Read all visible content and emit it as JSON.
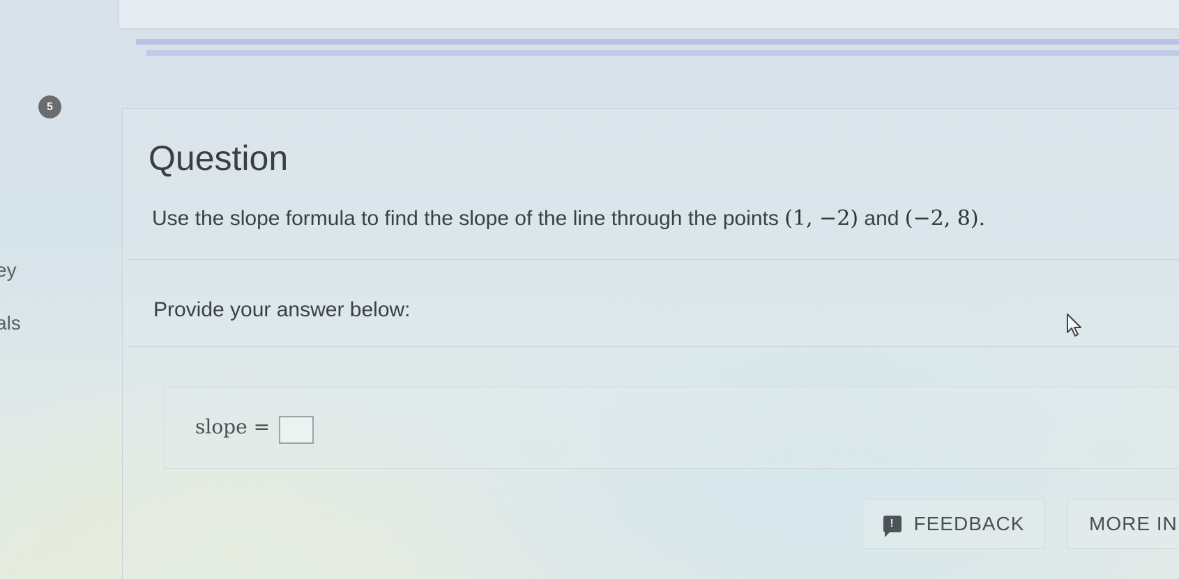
{
  "question": {
    "number": "5",
    "heading": "Question",
    "prompt_text": "Use the slope formula to find the slope of the line through the points",
    "point_1": "(1, −2)",
    "conjunction": "and",
    "point_2": "(−2, 8).",
    "answer_prompt": "Provide your answer below:"
  },
  "answer": {
    "label": "slope =",
    "value": ""
  },
  "buttons": {
    "feedback_label": "FEEDBACK",
    "more_info_label": "MORE IN"
  },
  "sidebar_fragments": {
    "item_1": "ey",
    "item_2": "als"
  },
  "icons": {
    "feedback": "feedback-icon",
    "cursor": "mouse-cursor-icon"
  },
  "colors": {
    "badge": "#6c6c70",
    "text": "#3b4045",
    "accent_line": "#b8c3e6"
  }
}
